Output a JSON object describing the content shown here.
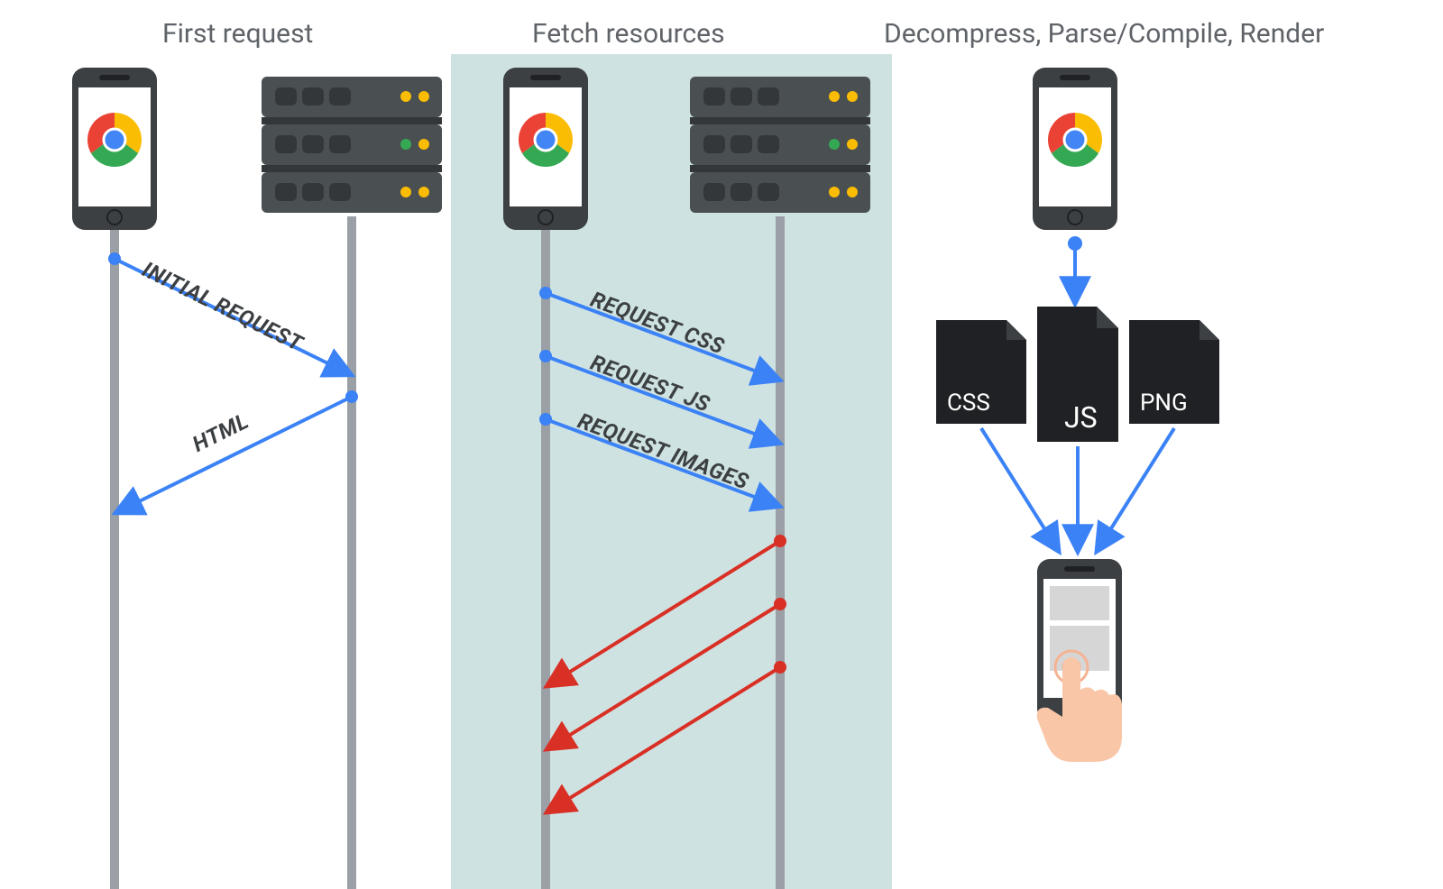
{
  "panels": {
    "first": {
      "title": "First request"
    },
    "fetch": {
      "title": "Fetch resources"
    },
    "render": {
      "title": "Decompress, Parse/Compile, Render"
    }
  },
  "arrows": {
    "initial_request": "INITIAL REQUEST",
    "html_response": "HTML",
    "request_css": "REQUEST CSS",
    "request_js": "REQUEST JS",
    "request_images": "REQUEST IMAGES"
  },
  "files": {
    "css": "CSS",
    "js": "JS",
    "png": "PNG"
  },
  "colors": {
    "panel_bg": "#cfe2e2",
    "arrow_blue": "#3b82f6",
    "arrow_red": "#d93025",
    "lifeline": "#9aa0a6",
    "title_grey": "#5f6368"
  }
}
